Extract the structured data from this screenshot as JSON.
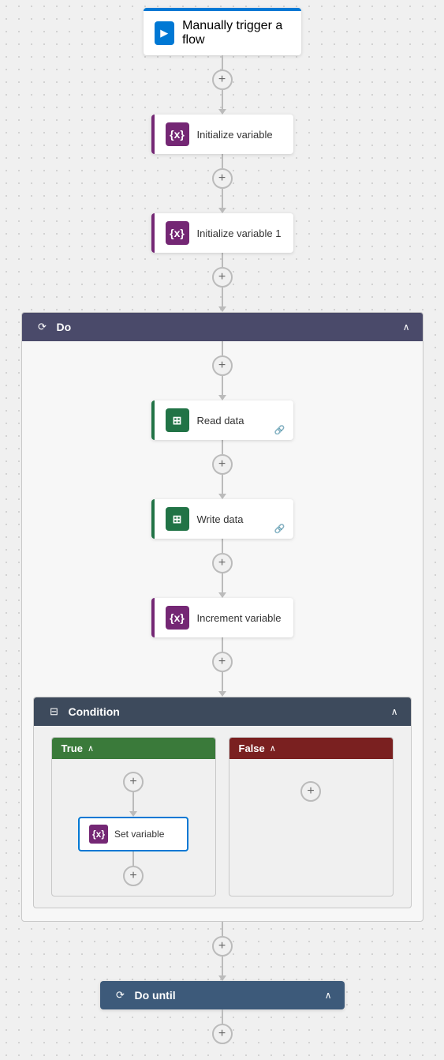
{
  "flow": {
    "trigger": {
      "label": "Manually trigger a flow",
      "icon_color": "#0078d4",
      "icon_symbol": "▶"
    },
    "steps": [
      {
        "id": "init-var",
        "label": "Initialize variable",
        "icon_color": "#742774",
        "icon_symbol": "{x}",
        "accent": "accent-purple"
      },
      {
        "id": "init-var-1",
        "label": "Initialize variable 1",
        "icon_color": "#742774",
        "icon_symbol": "{x}",
        "accent": "accent-purple"
      }
    ],
    "do_block": {
      "label": "Do",
      "inner_steps": [
        {
          "id": "read-data",
          "label": "Read data",
          "icon_color": "#217346",
          "icon_symbol": "⊞",
          "accent": "accent-green",
          "has_link": true
        },
        {
          "id": "write-data",
          "label": "Write data",
          "icon_color": "#217346",
          "icon_symbol": "⊞",
          "accent": "accent-green",
          "has_link": true
        },
        {
          "id": "increment-var",
          "label": "Increment variable",
          "icon_color": "#742774",
          "icon_symbol": "{x}",
          "accent": "accent-purple"
        }
      ],
      "condition": {
        "label": "Condition",
        "true_branch": {
          "label": "True",
          "steps": [
            {
              "id": "set-variable",
              "label": "Set variable",
              "icon_color": "#742774",
              "icon_symbol": "{x}"
            }
          ]
        },
        "false_branch": {
          "label": "False",
          "steps": []
        }
      }
    },
    "do_until": {
      "label": "Do until"
    },
    "add_button_label": "+",
    "chevron_collapsed": "∧",
    "chevron_expanded": "∨"
  }
}
